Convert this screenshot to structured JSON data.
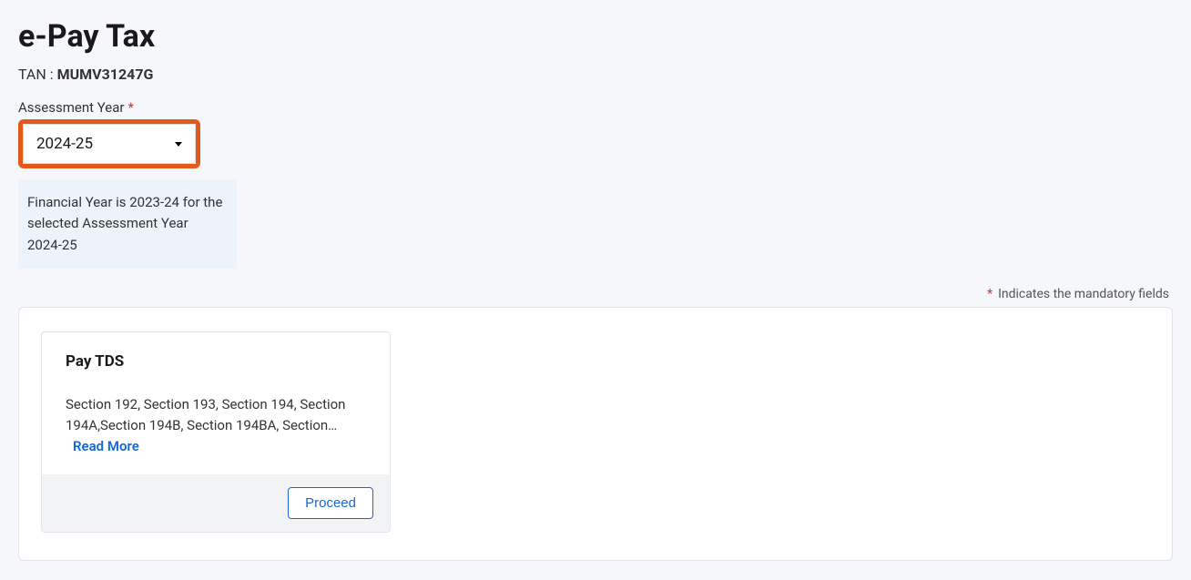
{
  "header": {
    "title": "e-Pay Tax",
    "tanLabel": "TAN : ",
    "tanValue": "MUMV31247G"
  },
  "assessmentYear": {
    "label": "Assessment Year",
    "selected": "2024-25",
    "infoText": "Financial Year is 2023-24 for the selected Assessment Year 2024-25"
  },
  "mandatoryNote": "Indicates the mandatory fields",
  "card": {
    "title": "Pay TDS",
    "description": "Section 192, Section 193, Section 194, Section 194A,Section 194B, Section 194BA, Section…",
    "readMore": "Read More",
    "proceed": "Proceed"
  }
}
